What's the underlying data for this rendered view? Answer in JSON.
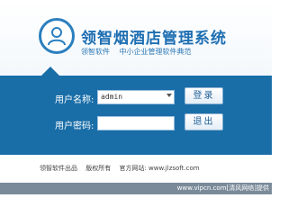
{
  "header": {
    "title": "领智烟酒店管理系统",
    "tagline_brand": "领智软件",
    "tagline_slogan": "中小企业管理软件典范"
  },
  "login": {
    "username_label": "用户名称:",
    "username_value": "admin",
    "password_label": "用户密码:",
    "password_value": "",
    "login_button": "登录",
    "exit_button": "退出"
  },
  "footer": {
    "publisher": "领智软件出品",
    "copyright": "版权所有",
    "website": "官方网站: www.jlzsoft.com"
  },
  "watermark": "www.vipcn.com[清风网络]提供",
  "colors": {
    "brand_blue": "#1a6ea8",
    "title_blue": "#1f6fb2"
  },
  "icons": {
    "logo": "user-icon",
    "dropdown": "chevron-down-icon"
  }
}
